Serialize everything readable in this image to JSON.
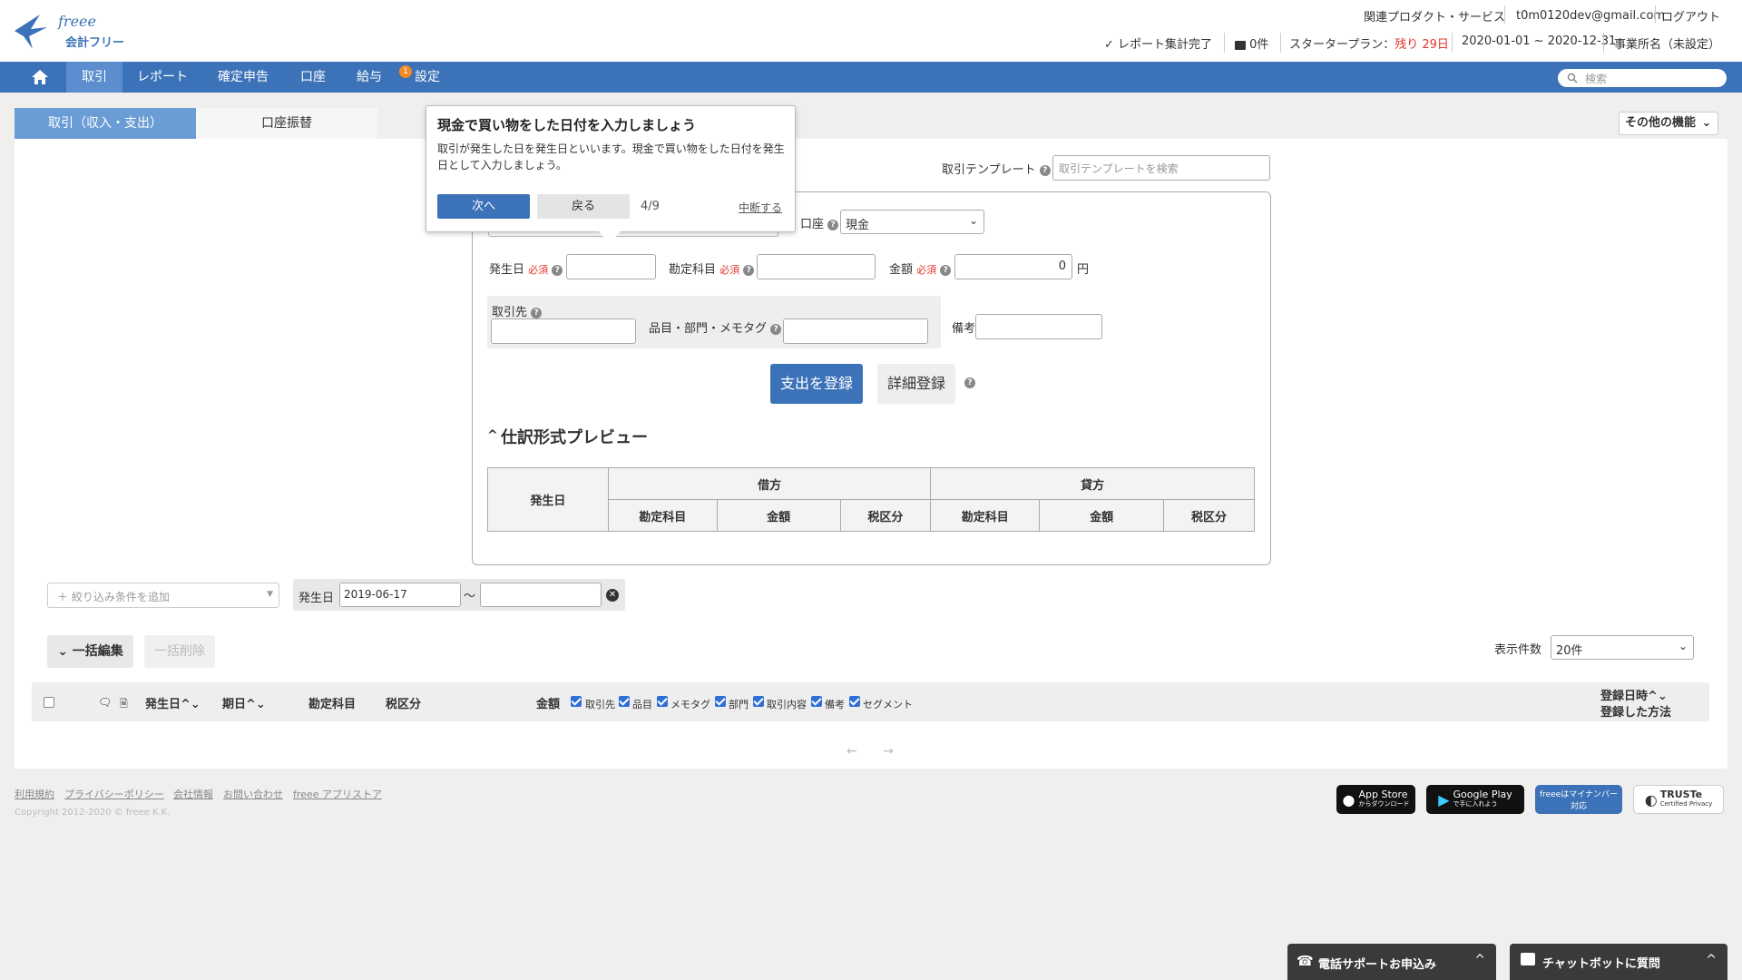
{
  "brand": {
    "logo_text": "freee",
    "sub_text": "会計フリー"
  },
  "header": {
    "links": [
      "関連プロダクト・サービス",
      "t0m0120dev@gmail.com",
      "ログアウト"
    ],
    "status_report": "レポート集計完了",
    "messages": "0件",
    "plan_prefix": "スタータープラン：",
    "plan_remaining": "残り 29日",
    "period": "2020-01-01 ~ 2020-12-31",
    "office": "事業所名（未設定）"
  },
  "nav": {
    "items": [
      "取引",
      "レポート",
      "確定申告",
      "口座",
      "給与",
      "設定"
    ],
    "settings_badge": "1",
    "search_placeholder": "検索"
  },
  "tabs": {
    "income_expense": "取引（収入・支出）",
    "transfer": "口座振替",
    "more": "その他の機能"
  },
  "tooltip": {
    "title": "現金で買い物をした日付を入力しましょう",
    "body": "取引が発生した日を発生日といいます。現金で買い物をした日付を発生日として入力しましょう。",
    "next": "次へ",
    "back": "戻る",
    "step": "4/9",
    "abort": "中断する"
  },
  "form": {
    "template_label": "取引テンプレート",
    "template_placeholder": "取引テンプレートを検索",
    "account_label": "口座",
    "account_value": "現金",
    "date_label": "発生日",
    "required": "必須",
    "subject_label": "勘定科目",
    "amount_label": "金額",
    "amount_value": "0",
    "yen": "円",
    "partner_label": "取引先",
    "item_label": "品目・部門・メモタグ",
    "note_label": "備考",
    "submit": "支出を登録",
    "detail": "詳細登録",
    "preview_title": "仕訳形式プレビュー",
    "table": {
      "date": "発生日",
      "debit": "借方",
      "credit": "貸方",
      "cols": [
        "勘定科目",
        "金額",
        "税区分",
        "勘定科目",
        "金額",
        "税区分"
      ]
    }
  },
  "filter": {
    "add_placeholder": "＋ 絞り込み条件を追加",
    "date_label": "発生日",
    "from": "2019-06-17",
    "tilde": "〜",
    "to": ""
  },
  "list": {
    "bulk_edit": "一括編集",
    "bulk_delete": "一括削除",
    "per_page_label": "表示件数",
    "per_page_value": "20件",
    "cols": {
      "date": "発生日",
      "due": "期日",
      "subject": "勘定科目",
      "tax": "税区分",
      "amount": "金額",
      "reg_time": "登録日時",
      "reg_method": "登録した方法"
    },
    "toggles": [
      "取引先",
      "品目",
      "メモタグ",
      "部門",
      "取引内容",
      "備考",
      "セグメント"
    ]
  },
  "footer": {
    "links": [
      "利用規約",
      "プライバシーポリシー",
      "会社情報",
      "お問い合わせ",
      "freee アプリストア"
    ],
    "copyright": "Copyright 2012-2020 © freee K.K.",
    "appstore_main": "App Store",
    "appstore_sub": "からダウンロード",
    "gplay_main": "Google Play",
    "gplay_sub": "で手に入れよう",
    "mynumber": "freeeはマイナンバー対応",
    "truste_main": "TRUSTe",
    "truste_sub": "Certified Privacy"
  },
  "support": {
    "phone": "電話サポートお申込み",
    "chatbot": "チャットボットに質問"
  },
  "colors": {
    "primary": "#3c72b8",
    "accent_red": "#e0372b",
    "badge": "#f08a24"
  }
}
